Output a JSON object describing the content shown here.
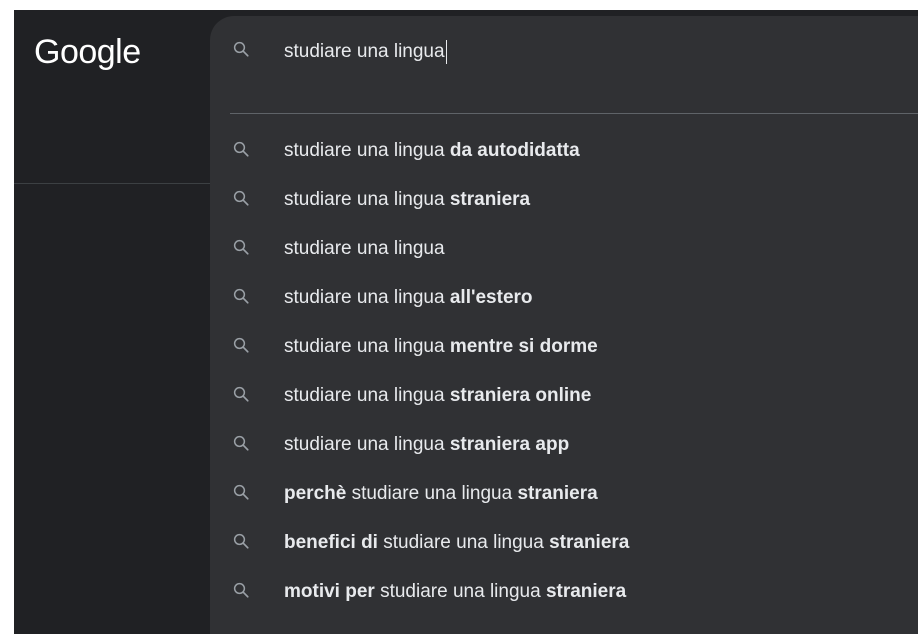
{
  "logo": {
    "text": "Google"
  },
  "colors": {
    "page_background": "#202124",
    "panel_background": "#303134",
    "text": "#e8eaed",
    "icon": "#9aa0a6",
    "divider": "#5f6368"
  },
  "search": {
    "query": "studiare una lingua",
    "icon": "search-icon"
  },
  "suggestions": [
    {
      "icon": "search-icon",
      "parts": [
        {
          "text": "studiare una lingua ",
          "bold": false
        },
        {
          "text": "da autodidatta",
          "bold": true
        }
      ]
    },
    {
      "icon": "search-icon",
      "parts": [
        {
          "text": "studiare una lingua ",
          "bold": false
        },
        {
          "text": "straniera",
          "bold": true
        }
      ]
    },
    {
      "icon": "search-icon",
      "parts": [
        {
          "text": "studiare una lingua",
          "bold": false
        }
      ]
    },
    {
      "icon": "search-icon",
      "parts": [
        {
          "text": "studiare una lingua ",
          "bold": false
        },
        {
          "text": "all'estero",
          "bold": true
        }
      ]
    },
    {
      "icon": "search-icon",
      "parts": [
        {
          "text": "studiare una lingua ",
          "bold": false
        },
        {
          "text": "mentre si dorme",
          "bold": true
        }
      ]
    },
    {
      "icon": "search-icon",
      "parts": [
        {
          "text": "studiare una lingua ",
          "bold": false
        },
        {
          "text": "straniera online",
          "bold": true
        }
      ]
    },
    {
      "icon": "search-icon",
      "parts": [
        {
          "text": "studiare una lingua ",
          "bold": false
        },
        {
          "text": "straniera app",
          "bold": true
        }
      ]
    },
    {
      "icon": "search-icon",
      "parts": [
        {
          "text": "perchè",
          "bold": true
        },
        {
          "text": " studiare una lingua ",
          "bold": false
        },
        {
          "text": "straniera",
          "bold": true
        }
      ]
    },
    {
      "icon": "search-icon",
      "parts": [
        {
          "text": "benefici di",
          "bold": true
        },
        {
          "text": " studiare una lingua ",
          "bold": false
        },
        {
          "text": "straniera",
          "bold": true
        }
      ]
    },
    {
      "icon": "search-icon",
      "parts": [
        {
          "text": "motivi per",
          "bold": true
        },
        {
          "text": " studiare una lingua ",
          "bold": false
        },
        {
          "text": "straniera",
          "bold": true
        }
      ]
    }
  ]
}
